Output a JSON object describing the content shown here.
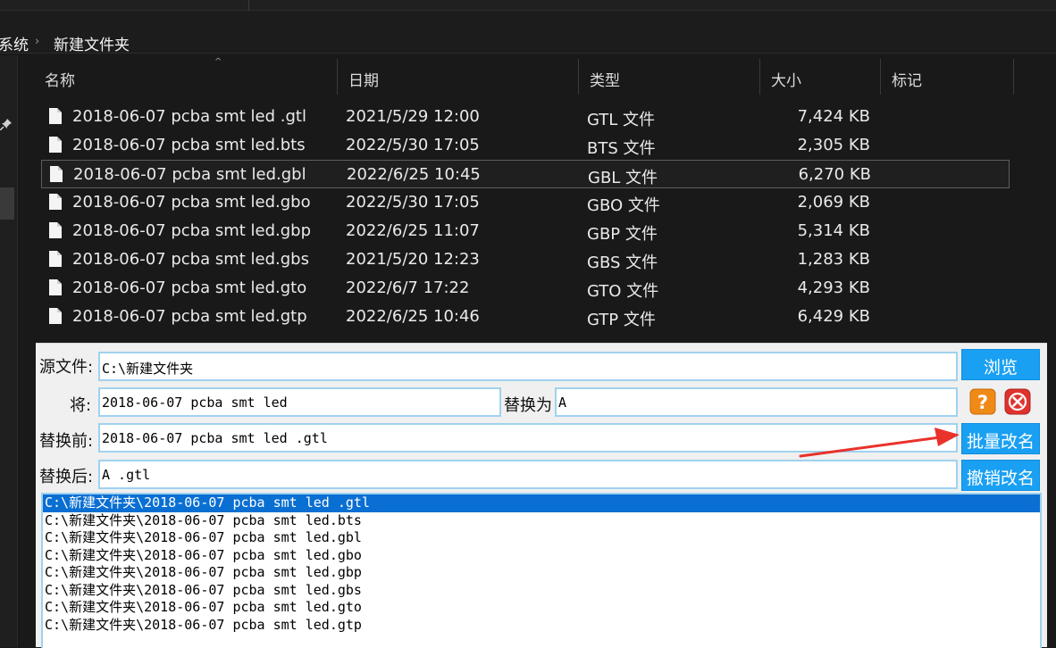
{
  "explorer": {
    "breadcrumb": {
      "previous": "系统",
      "separator": "›",
      "current": "新建文件夹"
    },
    "columns": {
      "name": "名称",
      "date": "日期",
      "type": "类型",
      "size": "大小",
      "tags": "标记"
    },
    "sort_indicator": "^",
    "files": [
      {
        "name": "2018-06-07 pcba smt led .gtl",
        "date": "2021/5/29 12:00",
        "type": "GTL 文件",
        "size": "7,424 KB"
      },
      {
        "name": "2018-06-07 pcba smt led.bts",
        "date": "2022/5/30 17:05",
        "type": "BTS 文件",
        "size": "2,305 KB"
      },
      {
        "name": "2018-06-07 pcba smt led.gbl",
        "date": "2022/6/25 10:45",
        "type": "GBL 文件",
        "size": "6,270 KB"
      },
      {
        "name": "2018-06-07 pcba smt led.gbo",
        "date": "2022/5/30 17:05",
        "type": "GBO 文件",
        "size": "2,069 KB"
      },
      {
        "name": "2018-06-07 pcba smt led.gbp",
        "date": "2022/6/25 11:07",
        "type": "GBP 文件",
        "size": "5,314 KB"
      },
      {
        "name": "2018-06-07 pcba smt led.gbs",
        "date": "2021/5/20 12:23",
        "type": "GBS 文件",
        "size": "1,283 KB"
      },
      {
        "name": "2018-06-07 pcba smt led.gto",
        "date": "2022/6/7 17:22",
        "type": "GTO 文件",
        "size": "4,293 KB"
      },
      {
        "name": "2018-06-07 pcba smt led.gtp",
        "date": "2022/6/25 10:46",
        "type": "GTP 文件",
        "size": "6,429 KB"
      }
    ]
  },
  "tool": {
    "source_label": "源文件:",
    "source_value": "C:\\新建文件夹",
    "browse_label": "浏览",
    "find_label": "将:",
    "find_value": "2018-06-07 pcba smt led",
    "replace_label": "替换为",
    "replace_value": "A",
    "before_label": "替换前:",
    "before_value": "2018-06-07 pcba smt led .gtl",
    "batch_rename_label": "批量改名",
    "after_label": "替换后:",
    "after_value": "A .gtl",
    "undo_rename_label": "撤销改名",
    "help_icon_color": "#f08a17",
    "close_icon_color": "#e0322d",
    "list": [
      "C:\\新建文件夹\\2018-06-07 pcba smt led .gtl",
      "C:\\新建文件夹\\2018-06-07 pcba smt led.bts",
      "C:\\新建文件夹\\2018-06-07 pcba smt led.gbl",
      "C:\\新建文件夹\\2018-06-07 pcba smt led.gbo",
      "C:\\新建文件夹\\2018-06-07 pcba smt led.gbp",
      "C:\\新建文件夹\\2018-06-07 pcba smt led.gbs",
      "C:\\新建文件夹\\2018-06-07 pcba smt led.gto",
      "C:\\新建文件夹\\2018-06-07 pcba smt led.gtp"
    ]
  },
  "colors": {
    "accent_button": "#1aa0f3",
    "list_selection": "#0a6fd2",
    "annotation_arrow": "#e8322a"
  }
}
